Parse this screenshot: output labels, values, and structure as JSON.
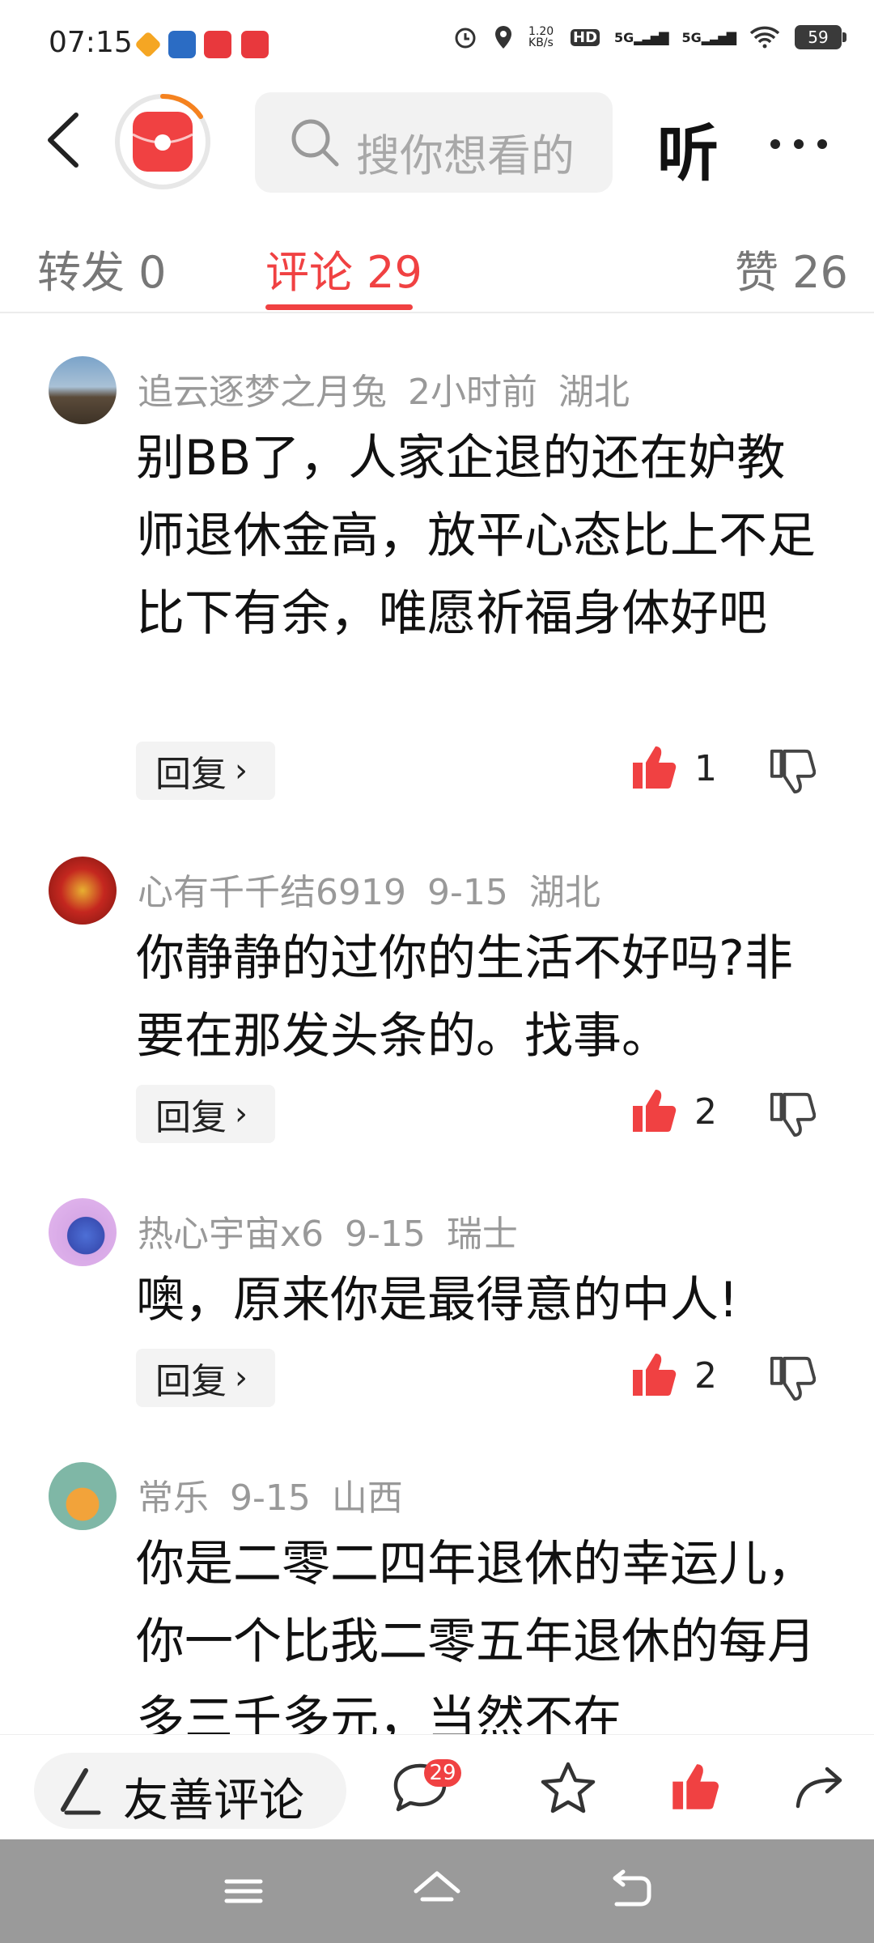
{
  "status_bar": {
    "time": "07:15",
    "net_speed": "1.20\nKB/s",
    "signal1": "5G",
    "signal2": "5G",
    "hd": "HD",
    "battery": "59"
  },
  "nav": {
    "search_placeholder": "搜你想看的",
    "listen_label": "听"
  },
  "tabs": [
    {
      "label": "转发 0"
    },
    {
      "label": "评论 29"
    },
    {
      "label": "赞 26"
    }
  ],
  "comments": [
    {
      "user": "追云逐梦之月兔",
      "time": "2小时前",
      "location": "湖北",
      "text": "别BB了，人家企退的还在妒教师退休金高，放平心态比上不足比下有余，唯愿祈福身体好吧",
      "reply_label": "回复",
      "likes": "1"
    },
    {
      "user": "心有千千结6919",
      "time": "9-15",
      "location": "湖北",
      "text": "你静静的过你的生活不好吗?非要在那发头条的。找事。",
      "reply_label": "回复",
      "likes": "2"
    },
    {
      "user": "热心宇宙x6",
      "time": "9-15",
      "location": "瑞士",
      "text": "噢，原来你是最得意的中人!",
      "reply_label": "回复",
      "likes": "2"
    },
    {
      "user": "常乐",
      "time": "9-15",
      "location": "山西",
      "text": "你是二零二四年退休的幸运儿，你一个比我二零五年退休的每月多三千多元，当然不在",
      "reply_label": "回复",
      "likes": ""
    }
  ],
  "bottom_bar": {
    "comment_placeholder": "友善评论",
    "comment_count": "29"
  },
  "colors": {
    "accent": "#f04142",
    "muted": "#999999"
  }
}
